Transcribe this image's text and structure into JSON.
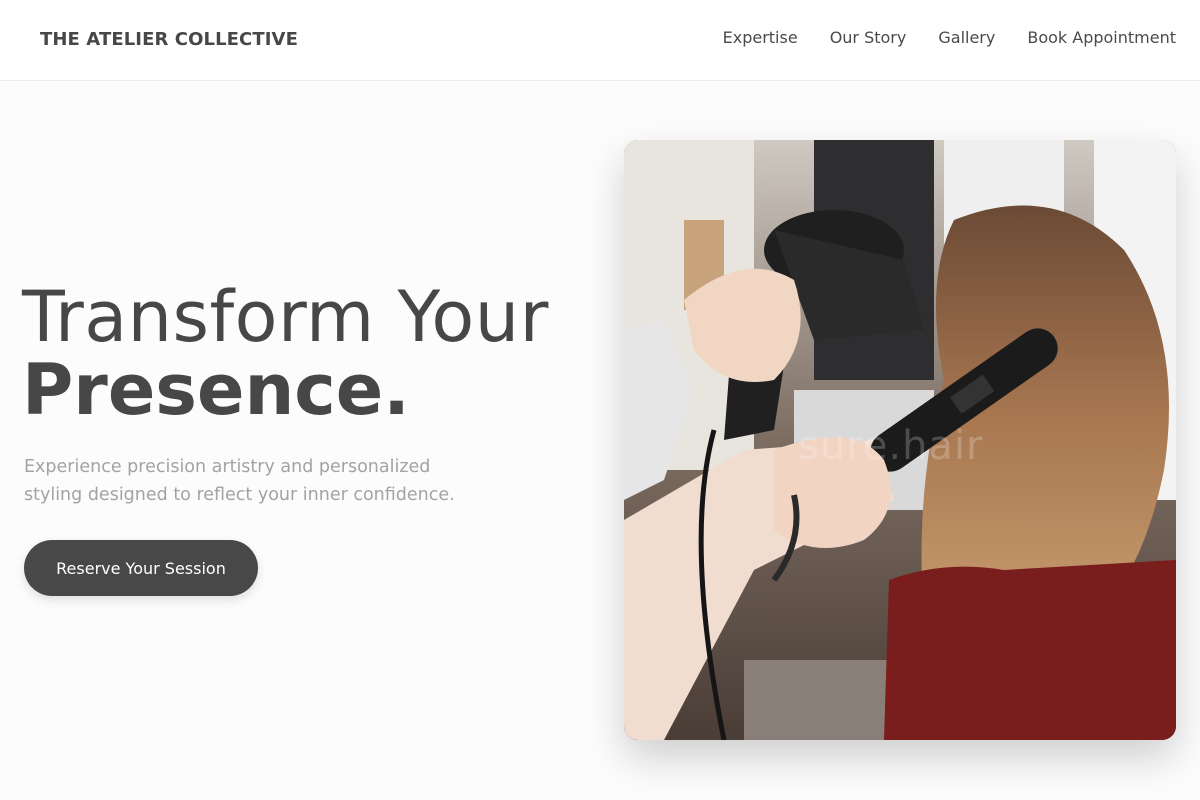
{
  "header": {
    "logo": "THE ATELIER COLLECTIVE",
    "nav": [
      "Expertise",
      "Our Story",
      "Gallery",
      "Book Appointment"
    ]
  },
  "hero": {
    "title_line1": "Transform Your",
    "title_line2": "Presence.",
    "subtitle": "Experience precision artistry and personalized styling designed to reflect your inner confidence.",
    "cta_label": "Reserve Your Session"
  },
  "photo": {
    "watermark": "sure.hair"
  },
  "colors": {
    "text": "#474747",
    "muted": "#a3a3a3",
    "button": "#484848",
    "background": "#fcfcfc"
  }
}
